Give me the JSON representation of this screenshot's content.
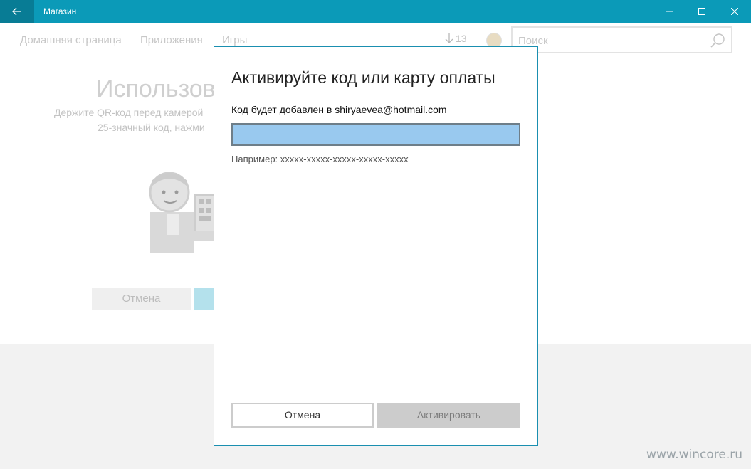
{
  "window": {
    "title": "Магазин"
  },
  "nav": {
    "items": [
      {
        "label": "Домашняя страница"
      },
      {
        "label": "Приложения"
      },
      {
        "label": "Игры"
      }
    ],
    "downloads_count": "13",
    "search_placeholder": "Поиск"
  },
  "background": {
    "heading": "Использова",
    "line1": "Держите QR-код перед камерой",
    "line2": "25-значный код, нажми",
    "cancel_label": "Отмена"
  },
  "dialog": {
    "title": "Активируйте код или карту оплаты",
    "label": "Код будет добавлен в shiryaevea@hotmail.com",
    "input_value": "",
    "hint": "Например: xxxxx-xxxxx-xxxxx-xxxxx-xxxxx",
    "cancel_label": "Отмена",
    "activate_label": "Активировать"
  },
  "watermark": "www.wincore.ru",
  "colors": {
    "titlebar": "#0b9ab8",
    "back_button": "#087c95",
    "dialog_border": "#1a8fb0",
    "input_fill": "#99c9ef"
  }
}
